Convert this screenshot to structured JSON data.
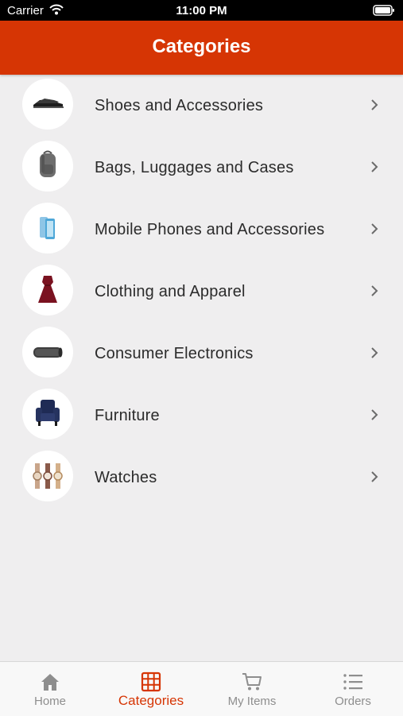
{
  "status_bar": {
    "carrier": "Carrier",
    "time": "11:00 PM"
  },
  "header": {
    "title": "Categories"
  },
  "categories": [
    {
      "label": "Shoes and Accessories",
      "icon": "shoes-icon"
    },
    {
      "label": "Bags, Luggages and Cases",
      "icon": "backpack-icon"
    },
    {
      "label": "Mobile Phones and Accessories",
      "icon": "phone-icon"
    },
    {
      "label": "Clothing and Apparel",
      "icon": "dress-icon"
    },
    {
      "label": "Consumer Electronics",
      "icon": "speaker-icon"
    },
    {
      "label": "Furniture",
      "icon": "armchair-icon"
    },
    {
      "label": "Watches",
      "icon": "watches-icon"
    }
  ],
  "tabs": [
    {
      "label": "Home",
      "icon": "home-icon",
      "active": false
    },
    {
      "label": "Categories",
      "icon": "grid-icon",
      "active": true
    },
    {
      "label": "My Items",
      "icon": "cart-icon",
      "active": false
    },
    {
      "label": "Orders",
      "icon": "list-icon",
      "active": false
    }
  ],
  "colors": {
    "accent": "#d63504",
    "background": "#efeeef",
    "tab_inactive": "#8e8e8e"
  }
}
